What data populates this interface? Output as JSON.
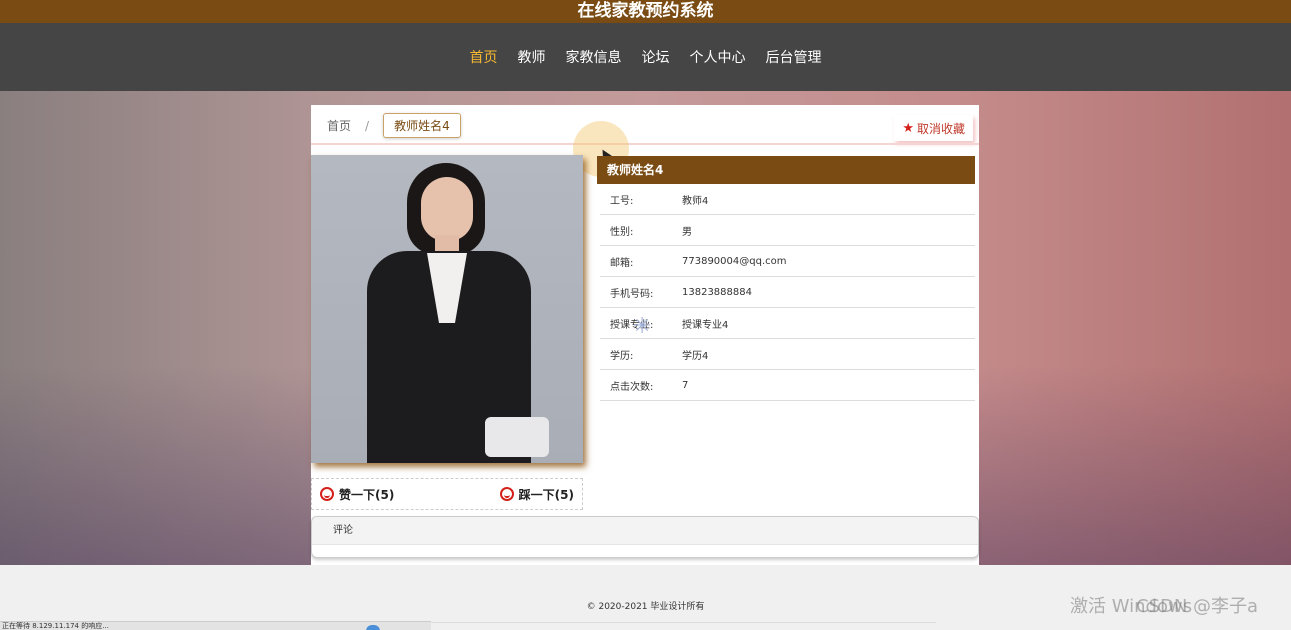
{
  "site_title": "在线家教预约系统",
  "nav": [
    {
      "label": "首页",
      "active": true
    },
    {
      "label": "教师",
      "active": false
    },
    {
      "label": "家教信息",
      "active": false
    },
    {
      "label": "论坛",
      "active": false
    },
    {
      "label": "个人中心",
      "active": false
    },
    {
      "label": "后台管理",
      "active": false
    }
  ],
  "breadcrumb": {
    "home": "首页",
    "separator": "/",
    "current": "教师姓名4"
  },
  "favorite_button": "取消收藏",
  "teacher": {
    "name": "教师姓名4",
    "fields": [
      {
        "label": "工号:",
        "value": "教师4"
      },
      {
        "label": "性别:",
        "value": "男"
      },
      {
        "label": "邮箱:",
        "value": "773890004@qq.com"
      },
      {
        "label": "手机号码:",
        "value": "13823888884"
      },
      {
        "label": "授课专业:",
        "value": "授课专业4"
      },
      {
        "label": "学历:",
        "value": "学历4"
      },
      {
        "label": "点击次数:",
        "value": "7"
      }
    ]
  },
  "votes": {
    "like": "赞一下(5)",
    "dislike": "踩一下(5)"
  },
  "comment_tab": "评论",
  "footer": {
    "copyright": "© 2020-2021 毕业设计所有"
  },
  "watermarks": {
    "windows": "激活 Windows",
    "csdn": "CSDN @李子a"
  },
  "statusbar": "正在等待 8.129.11.174 的响应...",
  "colors": {
    "brand": "#7a4c14",
    "nav_bg": "#454545",
    "nav_active": "#f5b731",
    "favorite": "#d4201a"
  }
}
